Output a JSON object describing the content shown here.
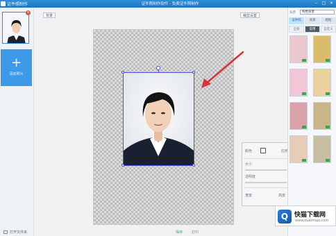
{
  "window": {
    "app_name": "证件照制作",
    "title": "证件照制作软件 - 免费证件照制作"
  },
  "left_panel": {
    "add_button_symbol": "+",
    "add_button_label": "添加照片",
    "bottom_label": "打开文件夹"
  },
  "canvas": {
    "btn_left": "背景",
    "btn_right": "裁剪设置"
  },
  "props_panel": {
    "color_label": "颜色",
    "apply_label": "应用",
    "size_label": "大小",
    "opacity_label": "透明度",
    "bottom_left": "宽度",
    "bottom_right": "高度"
  },
  "right_panel": {
    "label": "背景",
    "select_value": "纯色背景",
    "tabs": [
      "证件照",
      "背景",
      "相框"
    ],
    "subtabs": [
      "全部",
      "常用",
      "自定义"
    ],
    "tiles": [
      {
        "color": "#e9c9cf"
      },
      {
        "color": "#d9bd6a"
      },
      {
        "color": "#f1c6d5"
      },
      {
        "color": "#e9d29d"
      },
      {
        "color": "#d8a2a8"
      },
      {
        "color": "#c8b68a"
      },
      {
        "color": "#e7cdb9"
      },
      {
        "color": "#c6bda2"
      }
    ]
  },
  "bottom": {
    "ok_label": "保存",
    "mid_label": "打印"
  },
  "watermark": {
    "logo_letter": "Q",
    "title": "快猫下载网",
    "url": "www.kuaimiao.com"
  },
  "colors": {
    "titlebar": "#1f7ac6",
    "accent": "#3c9ae8",
    "selection": "#4a52e0",
    "arrow": "#d8323a"
  },
  "icons": [
    "app-icon",
    "close-icon",
    "minimize-icon",
    "maximize-icon",
    "add-icon",
    "folder-icon",
    "rotate-handle-icon",
    "arrow-annotation-icon"
  ]
}
